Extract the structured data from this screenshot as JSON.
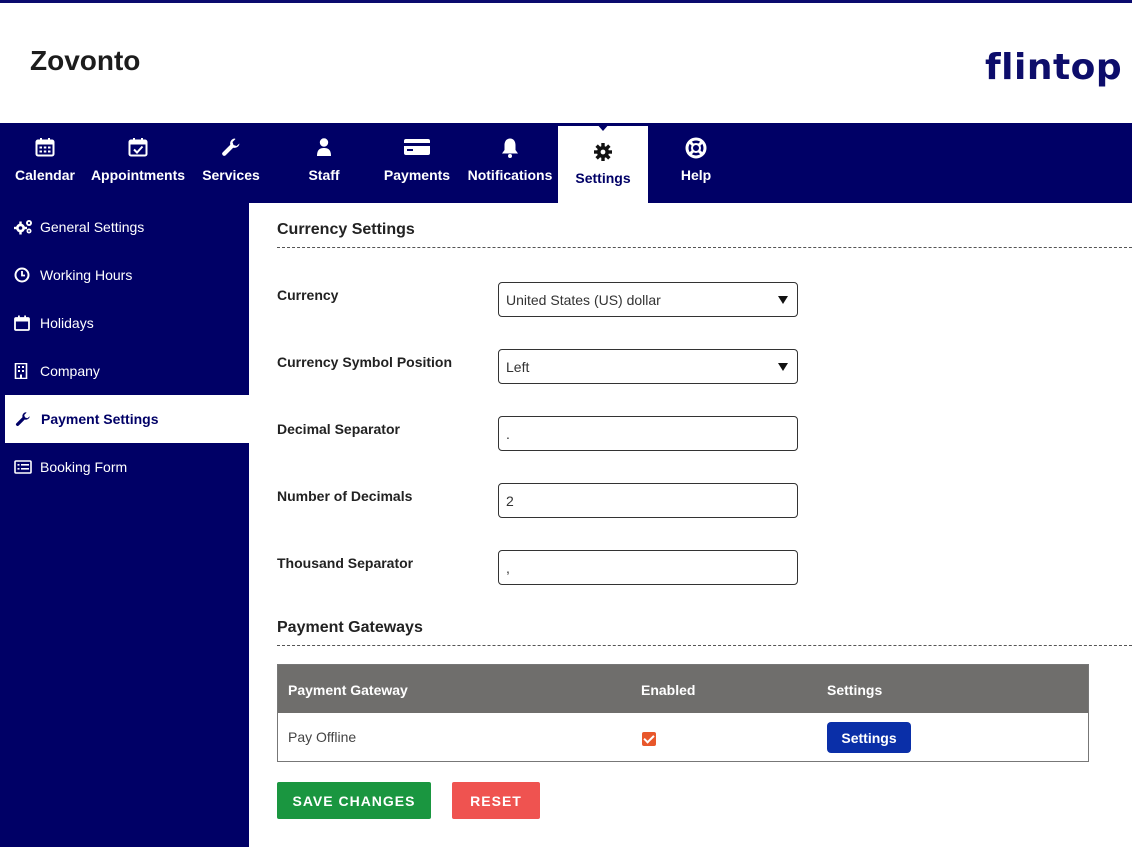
{
  "header": {
    "app_title": "Zovonto",
    "brand": "flintop"
  },
  "nav": {
    "items": [
      {
        "label": "Calendar",
        "icon": "calendar-icon"
      },
      {
        "label": "Appointments",
        "icon": "calendar-check-icon"
      },
      {
        "label": "Services",
        "icon": "wrench-icon"
      },
      {
        "label": "Staff",
        "icon": "user-icon"
      },
      {
        "label": "Payments",
        "icon": "credit-card-icon"
      },
      {
        "label": "Notifications",
        "icon": "bell-icon"
      },
      {
        "label": "Settings",
        "icon": "gear-icon",
        "active": true
      },
      {
        "label": "Help",
        "icon": "life-ring-icon"
      }
    ]
  },
  "sidebar": {
    "items": [
      {
        "label": "General Settings",
        "icon": "cogs-icon"
      },
      {
        "label": "Working Hours",
        "icon": "clock-icon"
      },
      {
        "label": "Holidays",
        "icon": "calendar-icon"
      },
      {
        "label": "Company",
        "icon": "building-icon"
      },
      {
        "label": "Payment Settings",
        "icon": "wrench-icon",
        "active": true
      },
      {
        "label": "Booking Form",
        "icon": "list-alt-icon"
      }
    ]
  },
  "currency_settings": {
    "title": "Currency Settings",
    "fields": [
      {
        "label": "Currency",
        "value": "United States (US) dollar",
        "type": "select"
      },
      {
        "label": "Currency Symbol Position",
        "value": "Left",
        "type": "select"
      },
      {
        "label": "Decimal Separator",
        "value": ".",
        "type": "text"
      },
      {
        "label": "Number of Decimals",
        "value": "2",
        "type": "text"
      },
      {
        "label": "Thousand Separator",
        "value": ",",
        "type": "text"
      }
    ]
  },
  "payment_gateways": {
    "title": "Payment Gateways",
    "columns": [
      "Payment Gateway",
      "Enabled",
      "Settings"
    ],
    "rows": [
      {
        "name": "Pay Offline",
        "enabled": true,
        "settings_label": "Settings"
      }
    ]
  },
  "actions": {
    "save_label": "SAVE CHANGES",
    "reset_label": "RESET"
  },
  "colors": {
    "nav_bg": "#000066",
    "save": "#1a9640",
    "reset": "#ef5350",
    "checkbox": "#e8572b",
    "settings_button": "#0a2fa8",
    "brand_dot": "#2bb34a"
  }
}
